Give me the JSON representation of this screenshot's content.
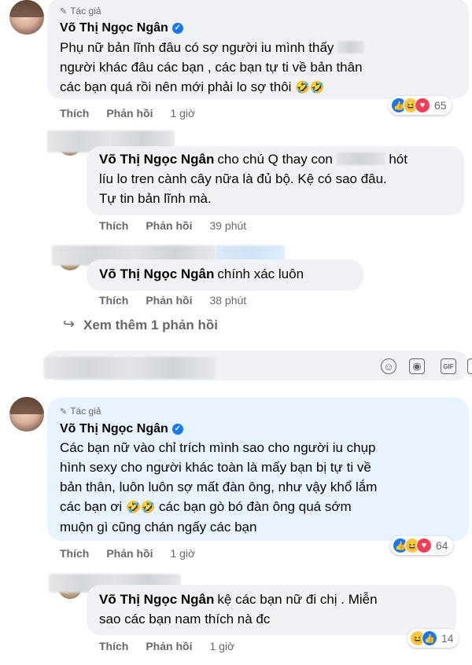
{
  "colors": {
    "accent": "#1877f2",
    "bubble": "#f0f2f5",
    "highlight_bubble": "#e7f3ff",
    "muted": "#65676b"
  },
  "comments": [
    {
      "author_tag": "Tác giả",
      "author": "Võ Thị Ngọc Ngân",
      "lines": [
        "Phụ nữ bản lĩnh đâu có sợ người iu mình thấy",
        "người khác đâu các bạn , các bạn tự ti về bản thân",
        "các bạn quá rồi nên mới phải lo sợ thôi"
      ],
      "emoji": "🤣🤣",
      "like": "Thích",
      "reply": "Phản hồi",
      "time": "1 giờ",
      "reaction_count": "65"
    },
    {
      "author": "Võ Thị Ngọc Ngân",
      "lines": [
        "cho chú Q thay con",
        "hót",
        "líu lo tren cành cây nữa là đủ bộ. Kệ có sao đâu.",
        "Tự tin bản lĩnh mà."
      ],
      "like": "Thích",
      "reply": "Phản hồi",
      "time": "39 phút"
    },
    {
      "author": "Võ Thị Ngọc Ngân",
      "lines": [
        "chính xác luôn"
      ],
      "like": "Thích",
      "reply": "Phản hồi",
      "time": "38 phút"
    },
    {
      "author_tag": "Tác giả",
      "author": "Võ Thị Ngọc Ngân",
      "lines": [
        "Các bạn nữ vào chỉ trích mình sao cho người iu chụp",
        "hình sexy cho người khác toàn là mấy bạn bị tự ti về",
        "bản thân, luôn luôn sợ mất đàn ông, như vậy khổ lắm",
        "các bạn ơi",
        "các bạn gò bó đàn ông quá sớm",
        "muộn gì cũng chán ngấy các bạn"
      ],
      "emoji": "🤣🤣",
      "like": "Thích",
      "reply": "Phản hồi",
      "time": "1 giờ",
      "reaction_count": "64"
    },
    {
      "author": "Võ Thị Ngọc Ngân",
      "lines": [
        "kệ các bạn nữ đi chị . Miễn",
        "sao các bạn nam thích nà đc"
      ],
      "like": "Thích",
      "reply": "Phản hồi",
      "time": "1 giờ",
      "reaction_count": "14"
    }
  ],
  "more_replies": "Xem thêm 1 phản hồi",
  "icons": [
    "pencil-icon",
    "verified-icon",
    "like-reaction-icon",
    "haha-reaction-icon",
    "love-reaction-icon",
    "reply-arrow-icon",
    "emoji-icon",
    "camera-icon",
    "gif-icon",
    "sticker-icon"
  ]
}
